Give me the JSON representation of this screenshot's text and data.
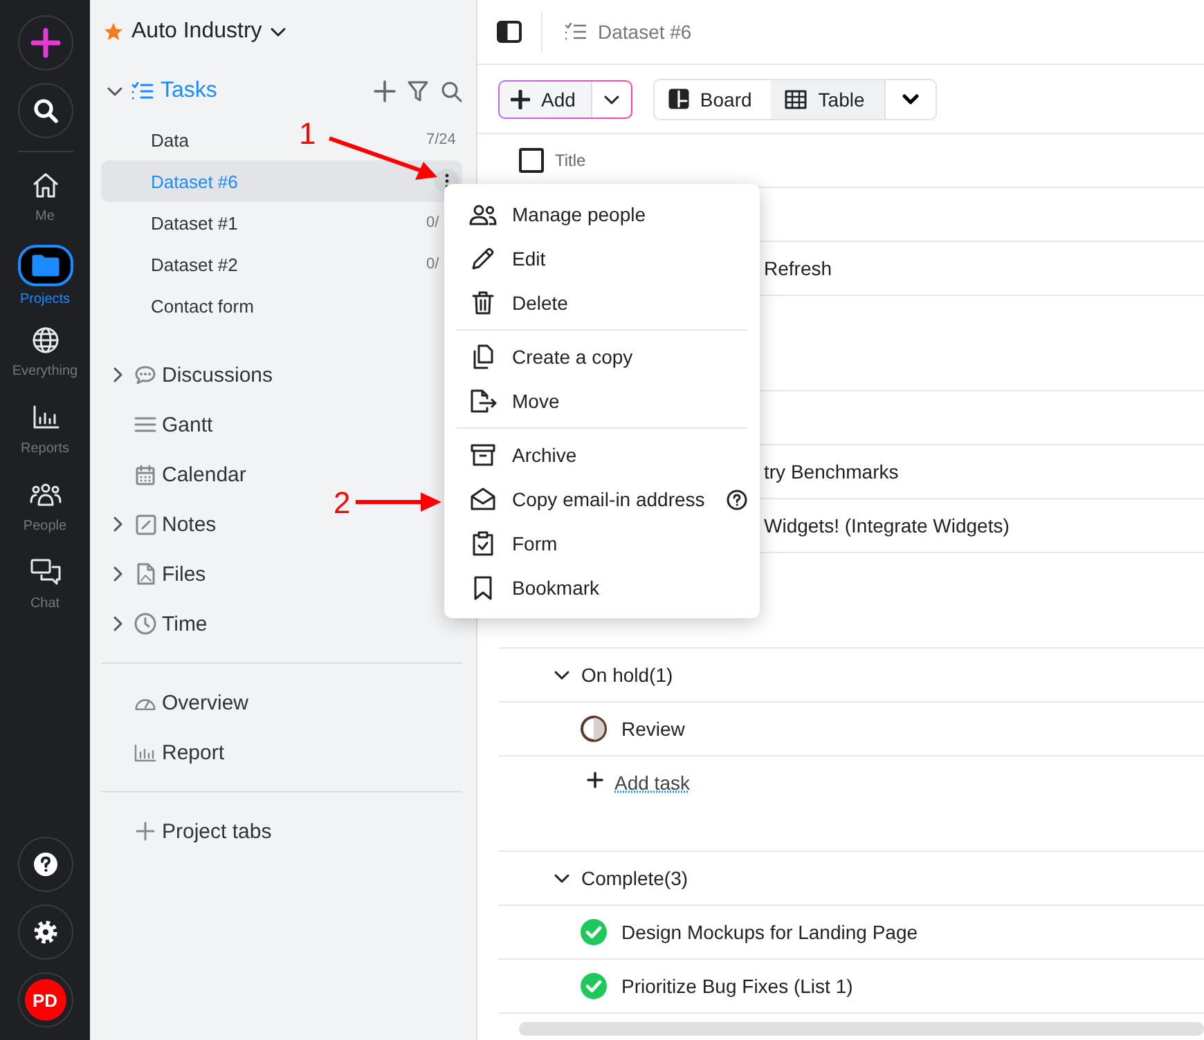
{
  "rail": {
    "items": [
      {
        "label": "Me",
        "selected": false
      },
      {
        "label": "Projects",
        "selected": true
      },
      {
        "label": "Everything",
        "selected": false
      },
      {
        "label": "Reports",
        "selected": false
      },
      {
        "label": "People",
        "selected": false
      },
      {
        "label": "Chat",
        "selected": false
      }
    ],
    "avatar": "PD"
  },
  "sidebar": {
    "project": "Auto Industry",
    "tasks": {
      "label": "Tasks",
      "expanded": true,
      "lists": [
        {
          "name": "Data",
          "count": "7/24",
          "selected": false
        },
        {
          "name": "Dataset #6",
          "selected": true
        },
        {
          "name": "Dataset #1",
          "count": "0/",
          "selected": false
        },
        {
          "name": "Dataset #2",
          "count": "0/",
          "selected": false
        },
        {
          "name": "Contact form",
          "selected": false
        }
      ]
    },
    "items": [
      {
        "label": "Discussions",
        "expanded": false
      },
      {
        "label": "Gantt"
      },
      {
        "label": "Calendar"
      },
      {
        "label": "Notes",
        "expanded": false
      },
      {
        "label": "Files",
        "expanded": false
      },
      {
        "label": "Time",
        "expanded": false
      }
    ],
    "views": [
      "Overview",
      "Report"
    ],
    "add_tab": "Project tabs"
  },
  "main": {
    "breadcrumb": "Dataset #6",
    "add_button": "Add",
    "views": [
      {
        "label": "Board",
        "selected": false
      },
      {
        "label": "Table",
        "selected": true
      }
    ],
    "select_all_checked": false,
    "column": "Title",
    "rows_behind_menu": [
      "Refresh",
      "try Benchmarks",
      "Widgets! (Integrate Widgets)"
    ],
    "groups": [
      {
        "label": "On hold(1)",
        "expanded": true,
        "tasks": [
          {
            "title": "Review",
            "kind": "on_hold"
          }
        ],
        "add_task": "Add task"
      },
      {
        "label": "Complete(3)",
        "expanded": true,
        "tasks": [
          {
            "title": "Design Mockups for Landing Page",
            "kind": "complete"
          },
          {
            "title": "Prioritize Bug Fixes (List 1)",
            "kind": "complete"
          }
        ]
      }
    ]
  },
  "context_menu": {
    "sections": [
      [
        {
          "label": "Manage people"
        },
        {
          "label": "Edit"
        },
        {
          "label": "Delete"
        }
      ],
      [
        {
          "label": "Create a copy"
        },
        {
          "label": "Move"
        }
      ],
      [
        {
          "label": "Archive"
        },
        {
          "label": "Copy email-in address",
          "help": true
        },
        {
          "label": "Form"
        },
        {
          "label": "Bookmark"
        }
      ]
    ]
  },
  "annotations": [
    "1",
    "2"
  ]
}
